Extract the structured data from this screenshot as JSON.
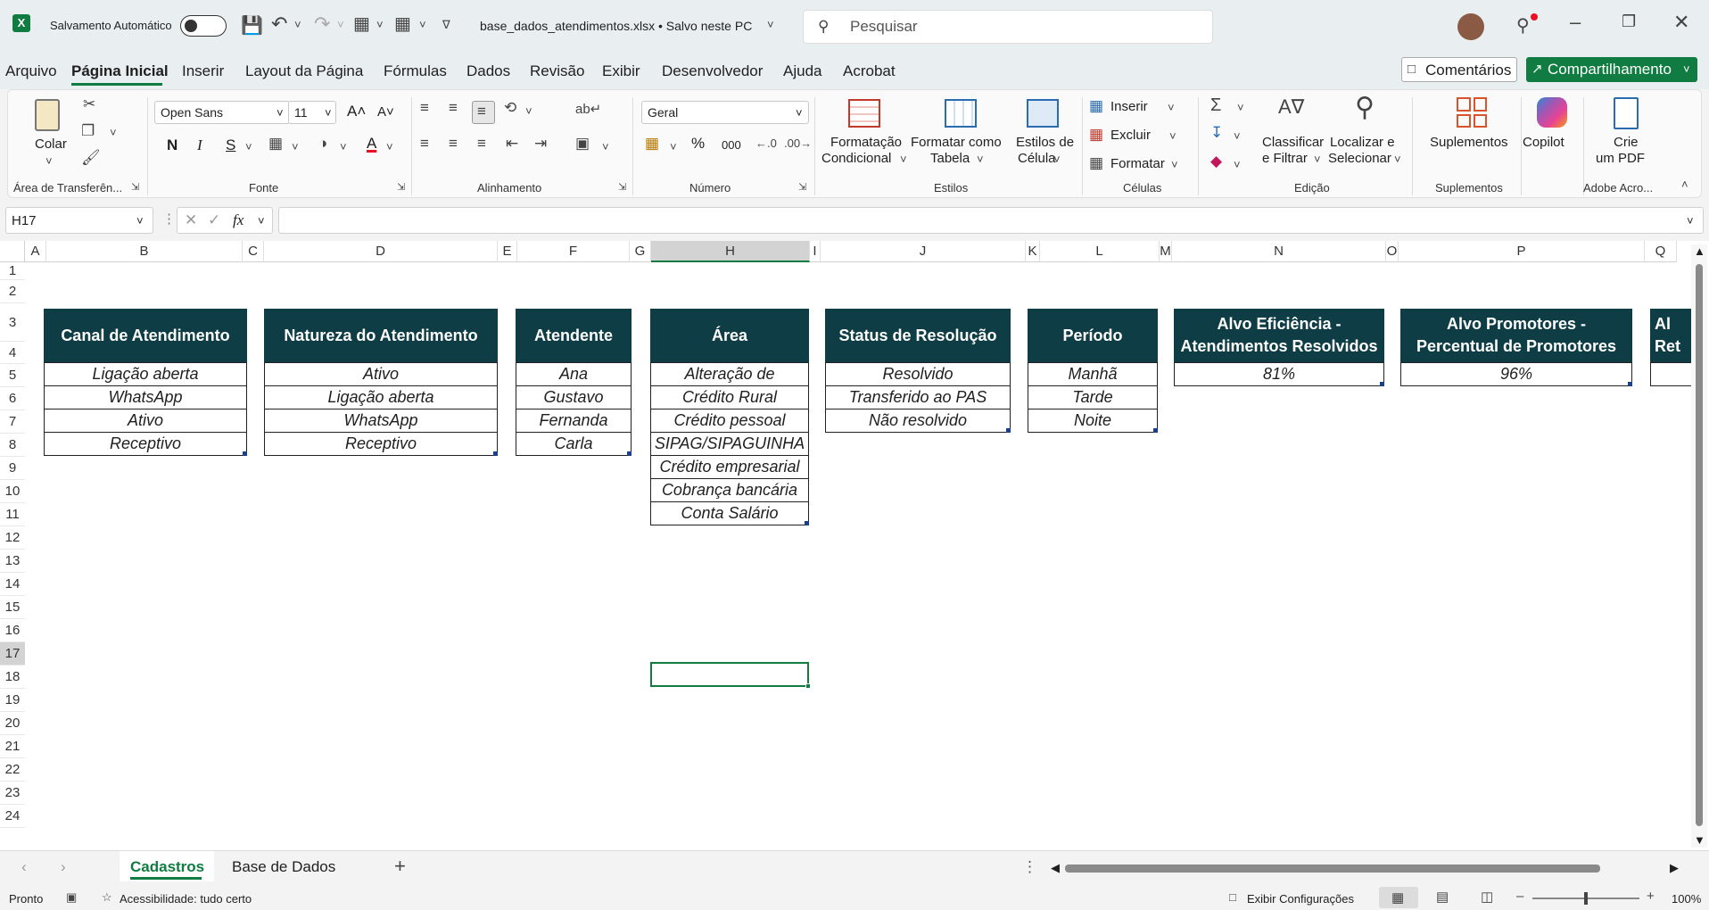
{
  "titlebar": {
    "autosave_label": "Salvamento Automático",
    "autosave_state": "off",
    "file_title": "base_dados_atendimentos.xlsx • Salvo neste PC",
    "search_placeholder": "Pesquisar"
  },
  "menu": [
    "Arquivo",
    "Página Inicial",
    "Inserir",
    "Layout da Página",
    "Fórmulas",
    "Dados",
    "Revisão",
    "Exibir",
    "Desenvolvedor",
    "Ajuda",
    "Acrobat"
  ],
  "menu_active": "Página Inicial",
  "comments_label": "Comentários",
  "share_label": "Compartilhamento",
  "ribbon": {
    "clipboard": {
      "paste": "Colar",
      "group": "Área de Transferên..."
    },
    "font": {
      "name": "Open Sans",
      "size": "11",
      "group": "Fonte",
      "bold": "N",
      "italic": "I",
      "underline": "S",
      "font_color": "#e81123"
    },
    "alignment": {
      "group": "Alinhamento"
    },
    "number": {
      "format": "Geral",
      "percent": "%",
      "thousands": "000",
      "group": "Número"
    },
    "styles": {
      "cond_format_1": "Formatação",
      "cond_format_2": "Condicional",
      "format_table_1": "Formatar como",
      "format_table_2": "Tabela",
      "cell_styles_1": "Estilos de",
      "cell_styles_2": "Célula",
      "group": "Estilos"
    },
    "cells": {
      "insert": "Inserir",
      "delete": "Excluir",
      "format": "Formatar",
      "group": "Células"
    },
    "editing": {
      "sort_1": "Classificar",
      "sort_2": "e Filtrar",
      "find_1": "Localizar e",
      "find_2": "Selecionar",
      "group": "Edição"
    },
    "addins": {
      "label": "Suplementos",
      "group": "Suplementos"
    },
    "copilot": {
      "label": "Copilot"
    },
    "adobe": {
      "label_1": "Crie",
      "label_2": "um PDF",
      "group": "Adobe Acro..."
    }
  },
  "formula_bar": {
    "name_box": "H17",
    "fx": "fx",
    "content": ""
  },
  "columns": [
    "A",
    "B",
    "C",
    "D",
    "E",
    "F",
    "G",
    "H",
    "I",
    "J",
    "K",
    "L",
    "M",
    "N",
    "O",
    "P",
    "Q"
  ],
  "rows": [
    "1",
    "2",
    "3",
    "4",
    "5",
    "6",
    "7",
    "8",
    "9",
    "10",
    "11",
    "12",
    "13",
    "14",
    "15",
    "16",
    "17",
    "18",
    "19",
    "20",
    "21",
    "22",
    "23",
    "24"
  ],
  "selected_cell": "H17",
  "tables": {
    "canal": {
      "header": "Canal de Atendimento",
      "items": [
        "Ligação aberta",
        "WhatsApp",
        "Ativo",
        "Receptivo"
      ]
    },
    "natureza": {
      "header": "Natureza do Atendimento",
      "items": [
        "Ativo",
        "Ligação aberta",
        "WhatsApp",
        "Receptivo"
      ]
    },
    "atendente": {
      "header": "Atendente",
      "items": [
        "Ana",
        "Gustavo",
        "Fernanda",
        "Carla"
      ]
    },
    "area": {
      "header": "Área",
      "items": [
        "Alteração de",
        "Crédito Rural",
        "Crédito pessoal",
        "SIPAG/SIPAGUINHA",
        "Crédito empresarial",
        "Cobrança bancária",
        "Conta Salário"
      ]
    },
    "status": {
      "header": "Status de Resolução",
      "items": [
        "Resolvido",
        "Transferido ao PAS",
        "Não resolvido"
      ]
    },
    "periodo": {
      "header": "Período",
      "items": [
        "Manhã",
        "Tarde",
        "Noite"
      ]
    },
    "alvo_eficiencia": {
      "header_1": "Alvo Eficiência -",
      "header_2": "Atendimentos Resolvidos",
      "value": "81%"
    },
    "alvo_promotores": {
      "header_1": "Alvo Promotores -",
      "header_2": "Percentual de Promotores",
      "value": "96%"
    },
    "partial": {
      "header_1": "Al",
      "header_2": "Ret"
    }
  },
  "sheets": [
    "Cadastros",
    "Base de Dados"
  ],
  "active_sheet": "Cadastros",
  "status": {
    "ready": "Pronto",
    "accessibility": "Acessibilidade: tudo certo",
    "display_settings": "Exibir Configurações",
    "zoom": "100%"
  }
}
